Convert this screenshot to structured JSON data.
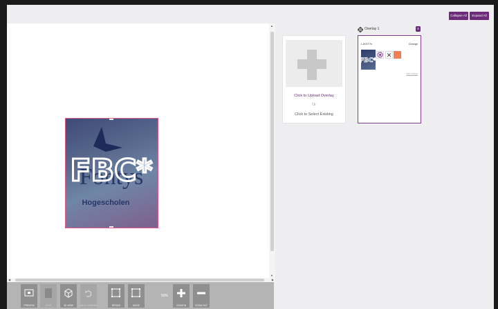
{
  "header": {
    "collapse_all": "Collapse All",
    "expand_all": "Expand All"
  },
  "overlay_image": {
    "text_main": "Fontys",
    "text_sub": "Hogescholen",
    "graffiti": "FBC*"
  },
  "toolbar": {
    "preview": "PREVIEW",
    "step": "STEP",
    "view_3d": "3D VIEW",
    "undo": "UNDO CHANGES",
    "resize": "RESIZE",
    "move": "MOVE",
    "zoom_level": "50%",
    "zoom_in": "ZOOM IN",
    "zoom_out": "ZOOM OUT"
  },
  "upload": {
    "click_upload": "Click to Upload Overlay",
    "or": "Or",
    "click_select": "Click to Select Existing"
  },
  "overlay_panel": {
    "title": "Overlay 1",
    "badge": "8",
    "id_text": "L1KGT7n",
    "change_label": "Change",
    "add_action": "Add Action",
    "swatch_color": "#f07f57"
  },
  "colors": {
    "accent": "#6b2b78",
    "selection_border": "#e15a8a"
  }
}
